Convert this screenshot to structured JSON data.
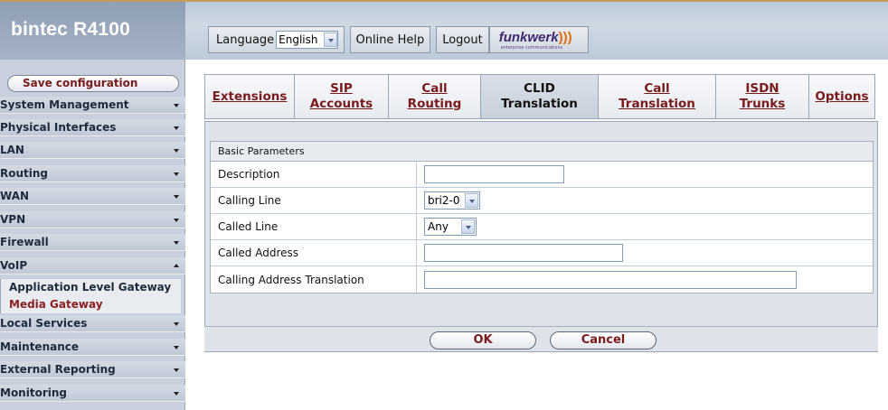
{
  "header": {
    "brand": "bintec R4100",
    "language_label": "Language",
    "language_value": "English",
    "online_help": "Online Help",
    "logout": "Logout",
    "logo_text": "funkwerk",
    "logo_tagline": "enterprise communications"
  },
  "sidebar": {
    "save": "Save configuration",
    "items": [
      {
        "label": "System Management"
      },
      {
        "label": "Physical Interfaces"
      },
      {
        "label": "LAN"
      },
      {
        "label": "Routing"
      },
      {
        "label": "WAN"
      },
      {
        "label": "VPN"
      },
      {
        "label": "Firewall"
      },
      {
        "label": "VoIP"
      },
      {
        "label": "Local Services"
      },
      {
        "label": "Maintenance"
      },
      {
        "label": "External Reporting"
      },
      {
        "label": "Monitoring"
      }
    ],
    "sub_items": [
      {
        "label": "Application Level Gateway"
      },
      {
        "label": "Media Gateway"
      }
    ]
  },
  "tabs": [
    {
      "label": "Extensions"
    },
    {
      "label": "SIP Accounts"
    },
    {
      "label": "Call Routing"
    },
    {
      "label": "CLID Translation"
    },
    {
      "label": "Call Translation"
    },
    {
      "label": "ISDN Trunks"
    },
    {
      "label": "Options"
    }
  ],
  "form": {
    "section": "Basic Parameters",
    "rows": [
      {
        "label": "Description",
        "value": ""
      },
      {
        "label": "Calling Line",
        "value": "bri2-0"
      },
      {
        "label": "Called Line",
        "value": "Any"
      },
      {
        "label": "Called Address",
        "value": ""
      },
      {
        "label": "Calling Address Translation",
        "value": ""
      }
    ]
  },
  "buttons": {
    "ok": "OK",
    "cancel": "Cancel"
  },
  "colors": {
    "link": "#7a1a1a",
    "sidebar_bg": "#c7d0dc",
    "panel_bg": "#dee3ea",
    "header_accent": "#c89b5a"
  }
}
